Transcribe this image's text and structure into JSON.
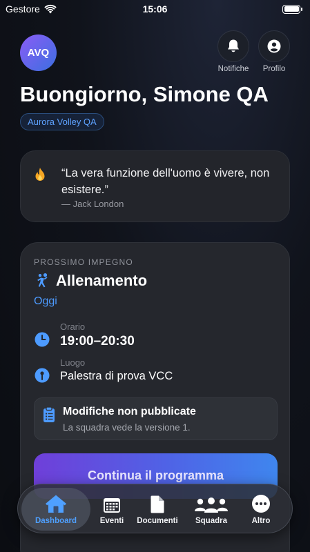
{
  "status_bar": {
    "carrier": "Gestore",
    "time": "15:06"
  },
  "header": {
    "avatar_initials": "AVQ",
    "notifications_label": "Notifiche",
    "profile_label": "Profilo",
    "greeting": "Buongiorno, Simone QA",
    "team_name": "Aurora Volley QA"
  },
  "quote": {
    "icon": "flame-icon",
    "text": "“La vera funzione dell'uomo è vivere, non esistere.”",
    "author": "— Jack London"
  },
  "next_event": {
    "kicker": "PROSSIMO IMPEGNO",
    "type_icon": "volleyball-player-icon",
    "title": "Allenamento",
    "date": "Oggi",
    "time_label": "Orario",
    "time_value": "19:00–20:30",
    "place_label": "Luogo",
    "place_value": "Palestra di prova VCC",
    "draft_title": "Modifiche non pubblicate",
    "draft_subtitle": "La squadra vede la versione 1.",
    "cta_label": "Continua il programma"
  },
  "tab_bar": {
    "active": "Dashboard",
    "tabs": [
      {
        "label": "Dashboard",
        "icon": "house-icon"
      },
      {
        "label": "Eventi",
        "icon": "calendar-icon"
      },
      {
        "label": "Documenti",
        "icon": "document-icon"
      },
      {
        "label": "Squadra",
        "icon": "people-icon"
      },
      {
        "label": "Altro",
        "icon": "more-icon"
      }
    ]
  },
  "colors": {
    "accent_blue": "#4d9bff",
    "cta_gradient_start": "#6f3fd9",
    "cta_gradient_end": "#3f86ee",
    "card_bg": "#25272d"
  }
}
